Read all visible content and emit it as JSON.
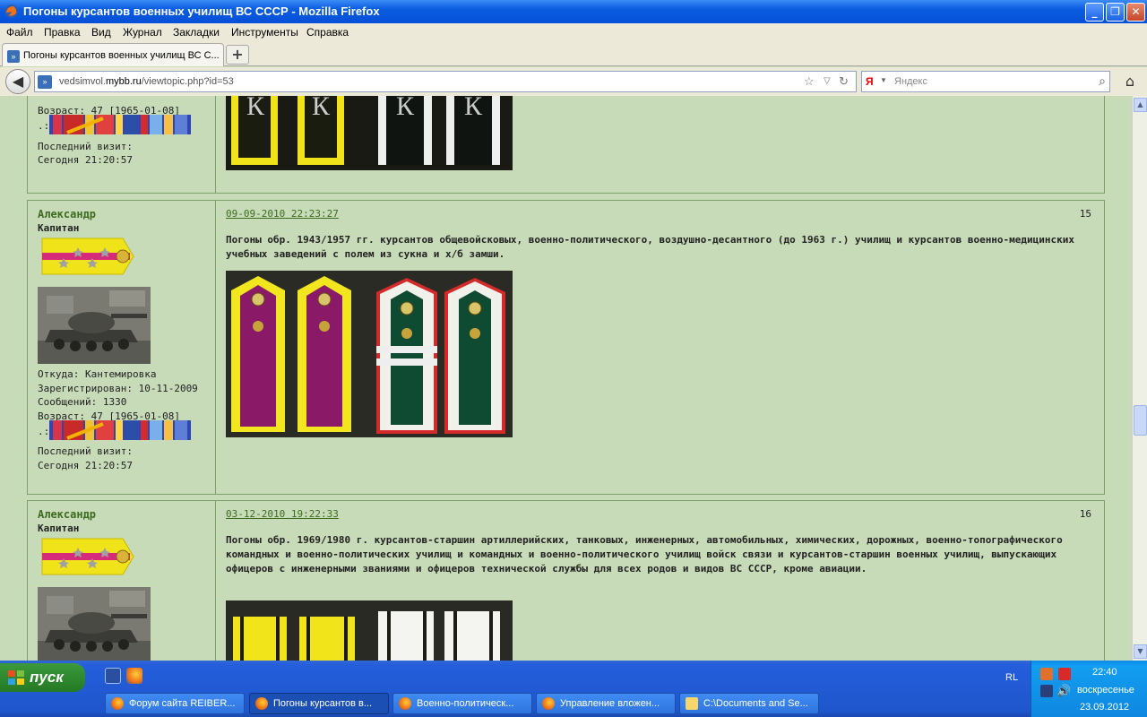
{
  "window": {
    "title": "Погоны курсантов военных училищ ВС СССР - Mozilla Firefox",
    "minimize": "_",
    "maximize": "❐",
    "close": "✕"
  },
  "menu": [
    "Файл",
    "Правка",
    "Вид",
    "Журнал",
    "Закладки",
    "Инструменты",
    "Справка"
  ],
  "tab": {
    "label": "Погоны курсантов военных училищ ВС С...",
    "new_tab": "+"
  },
  "nav": {
    "url_prefix": "vedsimvol.",
    "url_domain": "mybb.ru",
    "url_path": "/viewtopic.php?id=53",
    "search_engine": "Я",
    "search_placeholder": "Яндекс"
  },
  "posts": [
    {
      "id": "p14",
      "author": "",
      "rank": "",
      "age": "Возраст: 47 [1965-01-08]",
      "ribbon_label": ".:",
      "last_visit_label": "Последний визит:",
      "last_visit_value": "Сегодня 21:20:57"
    },
    {
      "id": "p15",
      "author": "Александр",
      "rank": "Капитан",
      "from": "Откуда: Кантемировка",
      "registered": "Зарегистрирован: 10-11-2009",
      "messages": "Сообщений: 1330",
      "age": "Возраст: 47 [1965-01-08]",
      "ribbon_label": ".:",
      "last_visit_label": "Последний визит:",
      "last_visit_value": "Сегодня 21:20:57",
      "date": "09-09-2010 22:23:27",
      "number": "15",
      "text": "Погоны обр. 1943/1957 гг. курсантов общевойсковых, военно-политического, воздушно-десантного (до 1963 г.) училищ и курсантов военно-медицинских учебных заведений с полем из сукна и х/б замши."
    },
    {
      "id": "p16",
      "author": "Александр",
      "rank": "Капитан",
      "date": "03-12-2010 19:22:33",
      "number": "16",
      "text": "Погоны обр. 1969/1980 г. курсантов-старшин артиллерийских, танковых, инженерных, автомобильных, химических, дорожных, военно-топографического командных и военно-политических училищ и командных и военно-политического училищ войск связи и курсантов-старшин военных училищ, выпускающих офицеров с инженерными званиями и офицеров технической службы для всех родов и видов ВС СССР, кроме авиации."
    }
  ],
  "taskbar": {
    "start": "пуск",
    "buttons": [
      {
        "label": "Форум сайта REIBER..."
      },
      {
        "label": "Погоны курсантов в..."
      },
      {
        "label": "Военно-политическ..."
      },
      {
        "label": "Управление вложен..."
      },
      {
        "label": "C:\\Documents and Se..."
      }
    ],
    "lang": "RL",
    "time": "22:40",
    "day": "воскресенье",
    "date": "23.09.2012"
  }
}
